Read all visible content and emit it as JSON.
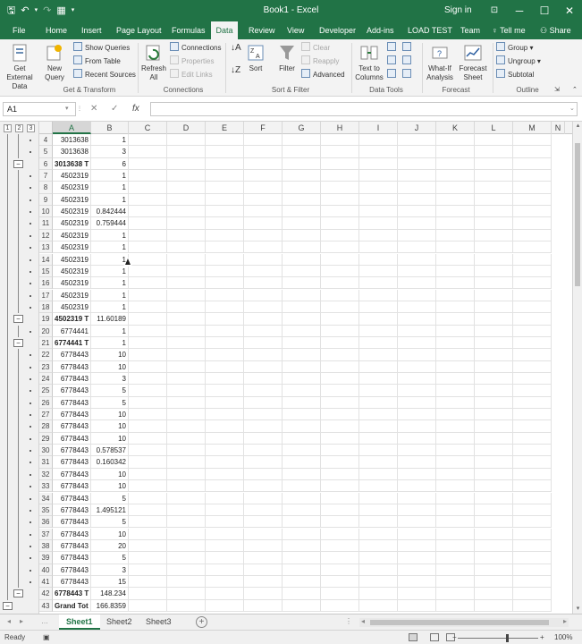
{
  "title_bar": {
    "window_title": "Book1 - Excel",
    "sign_in": "Sign in",
    "save_icon": "save-icon",
    "undo_icon": "undo-icon",
    "redo_icon": "redo-icon",
    "form_icon": "form-icon",
    "customize_icon": "customize-qat-icon",
    "ribbon_display_icon": "ribbon-display-icon",
    "minimize": "─",
    "maximize": "☐",
    "close": "✕"
  },
  "tabs": [
    "File",
    "Home",
    "Insert",
    "Page Layout",
    "Formulas",
    "Data",
    "Review",
    "View",
    "Developer",
    "Add-ins",
    "LOAD TEST",
    "Team"
  ],
  "tell_me": "Tell me",
  "share": "Share",
  "ribbon": {
    "get_external_data": "Get External Data",
    "new_query": "New Query",
    "show_queries": "Show Queries",
    "from_table": "From Table",
    "recent_sources": "Recent Sources",
    "group_get_transform": "Get & Transform",
    "refresh_all": "Refresh All",
    "connections": "Connections",
    "properties": "Properties",
    "edit_links": "Edit Links",
    "group_connections": "Connections",
    "sort": "Sort",
    "filter": "Filter",
    "clear": "Clear",
    "reapply": "Reapply",
    "advanced": "Advanced",
    "group_sort_filter": "Sort & Filter",
    "text_to_columns": "Text to Columns",
    "group_data_tools": "Data Tools",
    "what_if": "What-If Analysis",
    "forecast_sheet": "Forecast Sheet",
    "group_forecast": "Forecast",
    "group": "Group",
    "ungroup": "Ungroup",
    "subtotal": "Subtotal",
    "group_outline": "Outline"
  },
  "formula_bar": {
    "name_box": "A1",
    "cancel": "✕",
    "enter": "✓",
    "fx": "fx",
    "formula": ""
  },
  "outline_levels": [
    "1",
    "2",
    "3"
  ],
  "columns": [
    "A",
    "B",
    "C",
    "D",
    "E",
    "F",
    "G",
    "H",
    "I",
    "J",
    "K",
    "L",
    "M",
    "N"
  ],
  "rows": [
    {
      "n": "4",
      "a": "3013638",
      "b": "1"
    },
    {
      "n": "5",
      "a": "3013638",
      "b": "3"
    },
    {
      "n": "6",
      "a": "3013638 T",
      "b": "6",
      "total": true
    },
    {
      "n": "7",
      "a": "4502319",
      "b": "1"
    },
    {
      "n": "8",
      "a": "4502319",
      "b": "1"
    },
    {
      "n": "9",
      "a": "4502319",
      "b": "1"
    },
    {
      "n": "10",
      "a": "4502319",
      "b": "0.842444"
    },
    {
      "n": "11",
      "a": "4502319",
      "b": "0.759444"
    },
    {
      "n": "12",
      "a": "4502319",
      "b": "1"
    },
    {
      "n": "13",
      "a": "4502319",
      "b": "1"
    },
    {
      "n": "14",
      "a": "4502319",
      "b": "1"
    },
    {
      "n": "15",
      "a": "4502319",
      "b": "1"
    },
    {
      "n": "16",
      "a": "4502319",
      "b": "1"
    },
    {
      "n": "17",
      "a": "4502319",
      "b": "1"
    },
    {
      "n": "18",
      "a": "4502319",
      "b": "1"
    },
    {
      "n": "19",
      "a": "4502319 T",
      "b": "11.60189",
      "total": true
    },
    {
      "n": "20",
      "a": "6774441",
      "b": "1"
    },
    {
      "n": "21",
      "a": "6774441 T",
      "b": "1",
      "total": true
    },
    {
      "n": "22",
      "a": "6778443",
      "b": "10"
    },
    {
      "n": "23",
      "a": "6778443",
      "b": "10"
    },
    {
      "n": "24",
      "a": "6778443",
      "b": "3"
    },
    {
      "n": "25",
      "a": "6778443",
      "b": "5"
    },
    {
      "n": "26",
      "a": "6778443",
      "b": "5"
    },
    {
      "n": "27",
      "a": "6778443",
      "b": "10"
    },
    {
      "n": "28",
      "a": "6778443",
      "b": "10"
    },
    {
      "n": "29",
      "a": "6778443",
      "b": "10"
    },
    {
      "n": "30",
      "a": "6778443",
      "b": "0.578537"
    },
    {
      "n": "31",
      "a": "6778443",
      "b": "0.160342"
    },
    {
      "n": "32",
      "a": "6778443",
      "b": "10"
    },
    {
      "n": "33",
      "a": "6778443",
      "b": "10"
    },
    {
      "n": "34",
      "a": "6778443",
      "b": "5"
    },
    {
      "n": "35",
      "a": "6778443",
      "b": "1.495121"
    },
    {
      "n": "36",
      "a": "6778443",
      "b": "5"
    },
    {
      "n": "37",
      "a": "6778443",
      "b": "10"
    },
    {
      "n": "38",
      "a": "6778443",
      "b": "20"
    },
    {
      "n": "39",
      "a": "6778443",
      "b": "5"
    },
    {
      "n": "40",
      "a": "6778443",
      "b": "3"
    },
    {
      "n": "41",
      "a": "6778443",
      "b": "15"
    },
    {
      "n": "42",
      "a": "6778443 T",
      "b": "148.234",
      "total": true
    },
    {
      "n": "43",
      "a": "Grand Tot",
      "b": "166.8359",
      "total": true
    }
  ],
  "sheets": [
    "Sheet1",
    "Sheet2",
    "Sheet3"
  ],
  "active_sheet": "Sheet1",
  "status": {
    "ready": "Ready",
    "zoom": "100%"
  },
  "colors": {
    "brand": "#217346",
    "ribbon_bg": "#f3f3f3"
  }
}
